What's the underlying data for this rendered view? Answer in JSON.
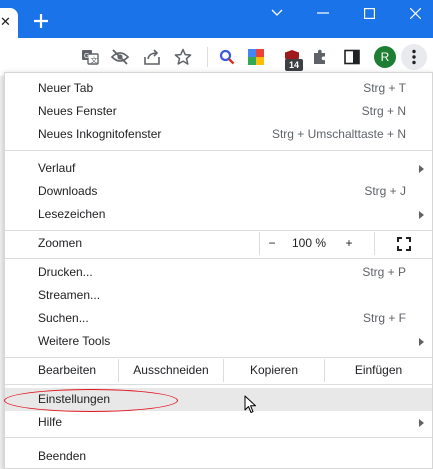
{
  "window": {
    "tab_close_glyph": "✕",
    "new_tab_icon": "plus-icon",
    "controls": [
      "chevron-down-icon",
      "minimize-icon",
      "maximize-icon",
      "close-icon"
    ]
  },
  "toolbar": {
    "icons": [
      "translate-icon",
      "eye-off-icon",
      "share-icon",
      "star-icon",
      "search-extension-icon",
      "google-extension-icon",
      "shield-extension-icon",
      "puzzle-icon",
      "sidebar-icon"
    ],
    "badge_count": "14",
    "avatar_letter": "R",
    "menu_icon": "kebab-icon"
  },
  "menu": {
    "group1": [
      {
        "label": "Neuer Tab",
        "shortcut": "Strg + T"
      },
      {
        "label": "Neues Fenster",
        "shortcut": "Strg + N"
      },
      {
        "label": "Neues Inkognitofenster",
        "shortcut": "Strg + Umschalttaste + N"
      }
    ],
    "group2": [
      {
        "label": "Verlauf",
        "shortcut": ""
      },
      {
        "label": "Downloads",
        "shortcut": "Strg + J"
      },
      {
        "label": "Lesezeichen",
        "shortcut": ""
      }
    ],
    "zoom": {
      "label": "Zoomen",
      "minus": "−",
      "value": "100 %",
      "plus": "+"
    },
    "group3": [
      {
        "label": "Drucken...",
        "shortcut": "Strg + P"
      },
      {
        "label": "Streamen...",
        "shortcut": ""
      },
      {
        "label": "Suchen...",
        "shortcut": "Strg + F"
      },
      {
        "label": "Weitere Tools",
        "shortcut": ""
      }
    ],
    "edit": {
      "label": "Bearbeiten",
      "cut": "Ausschneiden",
      "copy": "Kopieren",
      "paste": "Einfügen"
    },
    "settings": {
      "label": "Einstellungen"
    },
    "help": {
      "label": "Hilfe"
    },
    "exit": {
      "label": "Beenden"
    }
  },
  "colors": {
    "titlebar": "#1a73e8",
    "highlight": "#e8e8e8",
    "annotation_circle": "#e0141e"
  }
}
